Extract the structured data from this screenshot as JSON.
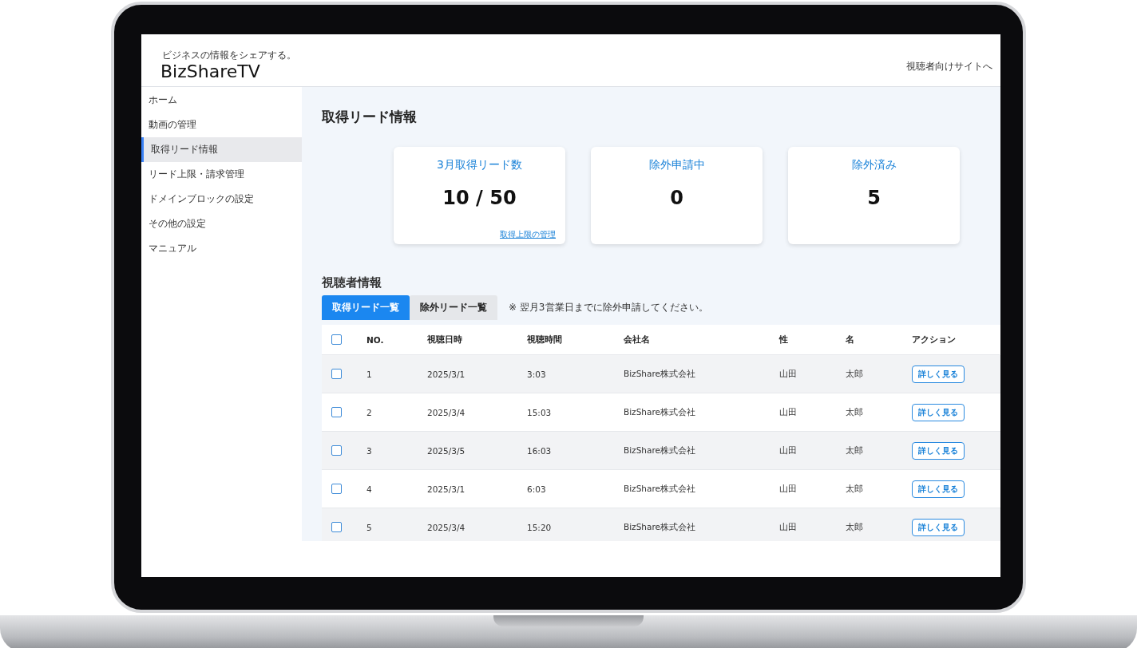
{
  "header": {
    "tagline": "ビジネスの情報をシェアする。",
    "logo": "BizShareTV",
    "link": "視聴者向けサイトへ"
  },
  "sidebar": {
    "items": [
      {
        "label": "ホーム",
        "selected": false
      },
      {
        "label": "動画の管理",
        "selected": false
      },
      {
        "label": "取得リード情報",
        "selected": true
      },
      {
        "label": "リード上限・請求管理",
        "selected": false
      },
      {
        "label": "ドメインブロックの設定",
        "selected": false
      },
      {
        "label": "その他の設定",
        "selected": false
      },
      {
        "label": "マニュアル",
        "selected": false
      }
    ]
  },
  "page_title": "取得リード情報",
  "cards": [
    {
      "title": "3月取得リード数",
      "value": "10 / 50",
      "link": "取得上限の管理"
    },
    {
      "title": "除外申請中",
      "value": "0"
    },
    {
      "title": "除外済み",
      "value": "5"
    }
  ],
  "section_title": "視聴者情報",
  "tabs": [
    {
      "label": "取得リード一覧",
      "selected": true
    },
    {
      "label": "除外リード一覧",
      "selected": false
    }
  ],
  "note": "※ 翌月3営業日までに除外申請してください。",
  "table": {
    "header_checked": false,
    "columns": [
      "NO.",
      "視聴日時",
      "視聴時間",
      "会社名",
      "性",
      "名",
      "アクション"
    ],
    "rows": [
      {
        "checked": false,
        "cells": [
          "1",
          "2025/3/1",
          "3:03",
          "BizShare株式会社",
          "山田",
          "太郎"
        ],
        "action": "詳しく見る"
      },
      {
        "checked": false,
        "cells": [
          "2",
          "2025/3/4",
          "15:03",
          "BizShare株式会社",
          "山田",
          "太郎"
        ],
        "action": "詳しく見る"
      },
      {
        "checked": false,
        "cells": [
          "3",
          "2025/3/5",
          "16:03",
          "BizShare株式会社",
          "山田",
          "太郎"
        ],
        "action": "詳しく見る"
      },
      {
        "checked": false,
        "cells": [
          "4",
          "2025/3/1",
          "6:03",
          "BizShare株式会社",
          "山田",
          "太郎"
        ],
        "action": "詳しく見る"
      },
      {
        "checked": false,
        "cells": [
          "5",
          "2025/3/4",
          "15:20",
          "BizShare株式会社",
          "山田",
          "太郎"
        ],
        "action": "詳しく見る"
      }
    ]
  }
}
